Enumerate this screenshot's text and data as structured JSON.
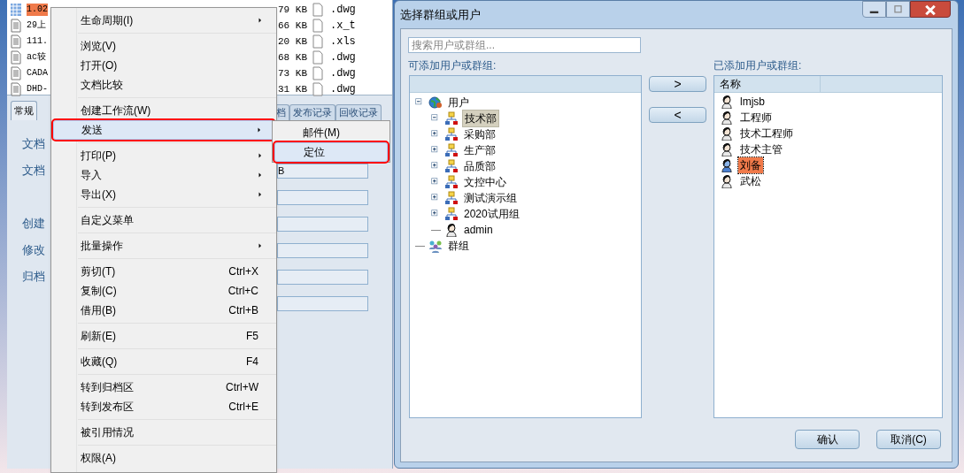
{
  "file_list": {
    "rows": [
      {
        "name": "1.02",
        "selected": true,
        "size": "79 KB",
        "ext": ".dwg"
      },
      {
        "name": "29上",
        "selected": false,
        "size": "66 KB",
        "ext": ".x_t"
      },
      {
        "name": "111.",
        "selected": false,
        "size": "20 KB",
        "ext": ".xls"
      },
      {
        "name": "ac较",
        "selected": false,
        "size": "68 KB",
        "ext": ".dwg"
      },
      {
        "name": "CADA",
        "selected": false,
        "size": "73 KB",
        "ext": ".dwg"
      },
      {
        "name": "DHD-",
        "selected": false,
        "size": "31 KB",
        "ext": ".dwg"
      }
    ]
  },
  "detail_tabs": [
    {
      "label": "常规",
      "selected": true
    },
    {
      "label": "档",
      "selected": false
    },
    {
      "label": "发布记录",
      "selected": false
    },
    {
      "label": "回收记录",
      "selected": false
    }
  ],
  "detail_fields": [
    {
      "kind": "labeled",
      "label": "文档"
    },
    {
      "kind": "labeled",
      "label": "文档",
      "value": "B"
    },
    {
      "kind": "unlabeled"
    },
    {
      "kind": "labeled",
      "label": "创建"
    },
    {
      "kind": "labeled",
      "label": "修改"
    },
    {
      "kind": "labeled",
      "label": "归档"
    },
    {
      "kind": "unlabeled"
    }
  ],
  "context_menu": {
    "items": [
      {
        "kind": "item",
        "label": "生命周期(I)",
        "submenu": true,
        "highlighted": false,
        "annotated": false
      },
      {
        "kind": "separator"
      },
      {
        "kind": "item",
        "label": "浏览(V)",
        "submenu": false,
        "highlighted": false,
        "annotated": false
      },
      {
        "kind": "item",
        "label": "打开(O)",
        "submenu": false,
        "highlighted": false,
        "annotated": false
      },
      {
        "kind": "item",
        "label": "文档比较",
        "submenu": false,
        "highlighted": false,
        "annotated": false
      },
      {
        "kind": "separator"
      },
      {
        "kind": "item",
        "label": "创建工作流(W)",
        "submenu": false,
        "highlighted": false,
        "annotated": false
      },
      {
        "kind": "item",
        "label": "发送",
        "submenu": true,
        "highlighted": true,
        "annotated": true
      },
      {
        "kind": "separator"
      },
      {
        "kind": "item",
        "label": "打印(P)",
        "submenu": true,
        "highlighted": false,
        "annotated": false
      },
      {
        "kind": "item",
        "label": "导入",
        "submenu": true,
        "highlighted": false,
        "annotated": false
      },
      {
        "kind": "item",
        "label": "导出(X)",
        "submenu": true,
        "highlighted": false,
        "annotated": false
      },
      {
        "kind": "separator"
      },
      {
        "kind": "item",
        "label": "自定义菜单",
        "submenu": false,
        "highlighted": false,
        "annotated": false
      },
      {
        "kind": "separator"
      },
      {
        "kind": "item",
        "label": "批量操作",
        "submenu": true,
        "highlighted": false,
        "annotated": false
      },
      {
        "kind": "separator"
      },
      {
        "kind": "item",
        "label": "剪切(T)",
        "shortcut": "Ctrl+X",
        "submenu": false,
        "highlighted": false,
        "annotated": false
      },
      {
        "kind": "item",
        "label": "复制(C)",
        "shortcut": "Ctrl+C",
        "submenu": false,
        "highlighted": false,
        "annotated": false
      },
      {
        "kind": "item",
        "label": "借用(B)",
        "shortcut": "Ctrl+B",
        "submenu": false,
        "highlighted": false,
        "annotated": false
      },
      {
        "kind": "separator"
      },
      {
        "kind": "item",
        "label": "刷新(E)",
        "shortcut": "F5",
        "submenu": false,
        "highlighted": false,
        "annotated": false
      },
      {
        "kind": "separator"
      },
      {
        "kind": "item",
        "label": "收藏(Q)",
        "shortcut": "F4",
        "submenu": false,
        "highlighted": false,
        "annotated": false
      },
      {
        "kind": "separator"
      },
      {
        "kind": "item",
        "label": "转到归档区",
        "shortcut": "Ctrl+W",
        "submenu": false,
        "highlighted": false,
        "annotated": false
      },
      {
        "kind": "item",
        "label": "转到发布区",
        "shortcut": "Ctrl+E",
        "submenu": false,
        "highlighted": false,
        "annotated": false
      },
      {
        "kind": "separator"
      },
      {
        "kind": "item",
        "label": "被引用情况",
        "submenu": false,
        "highlighted": false,
        "annotated": false
      },
      {
        "kind": "separator"
      },
      {
        "kind": "item",
        "label": "权限(A)",
        "submenu": false,
        "highlighted": false,
        "annotated": false
      }
    ]
  },
  "submenu": {
    "items": [
      {
        "label": "邮件(M)",
        "highlighted": false,
        "annotated": false
      },
      {
        "label": "定位",
        "highlighted": true,
        "annotated": true
      }
    ]
  },
  "dialog": {
    "title": "选择群组或用户",
    "search_placeholder": "搜索用户或群组...",
    "available_label": "可添加用户或群组:",
    "tree": [
      {
        "label": "用户",
        "kind": "users-root",
        "expanded": true,
        "selected": false,
        "children": [
          {
            "label": "技术部",
            "kind": "department",
            "expanded": true,
            "selected": true
          },
          {
            "label": "采购部",
            "kind": "department",
            "expanded": false,
            "selected": false
          },
          {
            "label": "生产部",
            "kind": "department",
            "expanded": false,
            "selected": false
          },
          {
            "label": "品质部",
            "kind": "department",
            "expanded": false,
            "selected": false
          },
          {
            "label": "文控中心",
            "kind": "department",
            "expanded": false,
            "selected": false
          },
          {
            "label": "测试演示组",
            "kind": "department",
            "expanded": false,
            "selected": false
          },
          {
            "label": "2020试用组",
            "kind": "department",
            "expanded": false,
            "selected": false
          },
          {
            "label": "admin",
            "kind": "user",
            "selected": false
          }
        ]
      },
      {
        "label": "群组",
        "kind": "groups-root",
        "selected": false
      }
    ],
    "add_button": ">",
    "remove_button": "<",
    "added_label": "已添加用户或群组:",
    "added_columns": [
      "名称"
    ],
    "added_items": [
      {
        "name": "lmjsb",
        "selected": false
      },
      {
        "name": "工程师",
        "selected": false
      },
      {
        "name": "技术工程师",
        "selected": false
      },
      {
        "name": "技术主管",
        "selected": false
      },
      {
        "name": "刘备",
        "selected": true
      },
      {
        "name": "武松",
        "selected": false
      }
    ],
    "buttons": [
      "确认",
      "取消(C)"
    ]
  }
}
